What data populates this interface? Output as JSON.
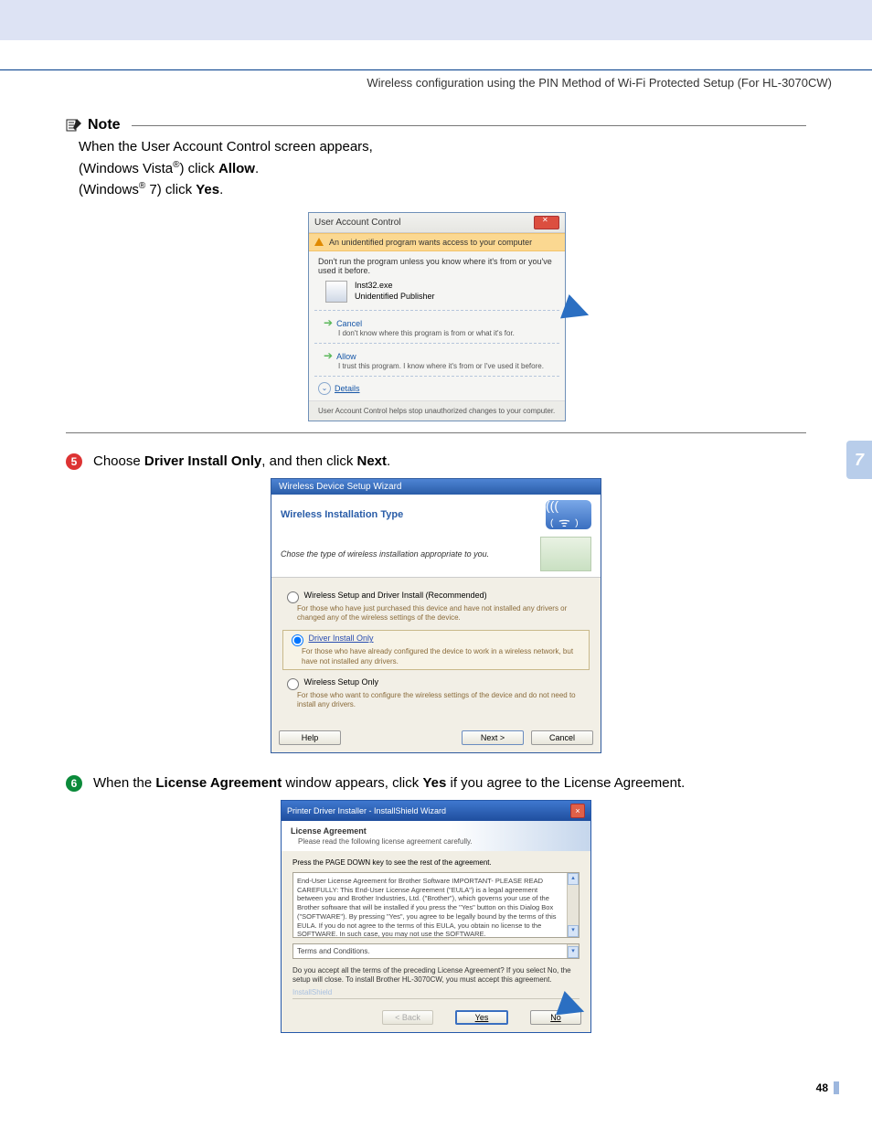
{
  "header": {
    "breadcrumb": "Wireless configuration using the PIN Method of Wi-Fi Protected Setup (For HL-3070CW)"
  },
  "note": {
    "title": "Note",
    "line1": "When the User Account Control screen appears,",
    "line2a": "(Windows Vista",
    "line2b": ") click ",
    "line2c": "Allow",
    "line2d": ".",
    "line3a": "(Windows",
    "line3b": " 7) click ",
    "line3c": "Yes",
    "line3d": "."
  },
  "uac": {
    "title": "User Account Control",
    "warn": "An unidentified program wants access to your computer",
    "msg": "Don't run the program unless you know where it's from or you've used it before.",
    "prog_name": "Inst32.exe",
    "prog_pub": "Unidentified Publisher",
    "cancel": "Cancel",
    "cancel_sub": "I don't know where this program is from or what it's for.",
    "allow": "Allow",
    "allow_sub": "I trust this program. I know where it's from or I've used it before.",
    "details": "Details",
    "footer": "User Account Control helps stop unauthorized changes to your computer."
  },
  "step5": {
    "num": "5",
    "pre": "Choose ",
    "bold1": "Driver Install Only",
    "mid": ", and then click ",
    "bold2": "Next",
    "post": "."
  },
  "wizard": {
    "title": "Wireless Device Setup Wizard",
    "heading": "Wireless Installation Type",
    "sub": "Chose the type of wireless installation appropriate to you.",
    "opt1": {
      "label": "Wireless Setup and Driver Install (Recommended)",
      "desc": "For those who have just purchased this device and have not installed any drivers or changed any of the wireless settings of the device."
    },
    "opt2": {
      "label": "Driver Install Only",
      "desc": "For those who have already configured the device to work in a wireless network, but have not installed any drivers."
    },
    "opt3": {
      "label": "Wireless Setup Only",
      "desc": "For those who want to configure the wireless settings of the device and do not need to install any drivers."
    },
    "help": "Help",
    "next": "Next >",
    "cancel": "Cancel"
  },
  "step6": {
    "num": "6",
    "pre": "When the ",
    "bold1": "License Agreement",
    "mid": " window appears, click ",
    "bold2": "Yes",
    "post": " if you agree to the License Agreement."
  },
  "license": {
    "title": "Printer Driver Installer - InstallShield Wizard",
    "head_title": "License Agreement",
    "head_sub": "Please read the following license agreement carefully.",
    "instruction": "Press the PAGE DOWN key to see the rest of the agreement.",
    "eula": "End-User License Agreement for Brother Software IMPORTANT- PLEASE READ CAREFULLY: This End-User License Agreement (\"EULA\") is a legal agreement between you and Brother Industries, Ltd. (\"Brother\"), which governs your use of the Brother software that will be installed if you press the \"Yes\" button on this Dialog Box (\"SOFTWARE\"). By pressing \"Yes\", you agree to be legally bound by the terms of this EULA. If you do not agree to the terms of this EULA, you obtain no license to the SOFTWARE. In such case, you may not use the SOFTWARE.",
    "terms": "Terms and Conditions.",
    "question": "Do you accept all the terms of the preceding License Agreement? If you select No, the setup will close. To install Brother HL-3070CW, you must accept this agreement.",
    "brand": "InstallShield",
    "back": "< Back",
    "yes": "Yes",
    "no": "No"
  },
  "side_tab": "7",
  "page_number": "48"
}
